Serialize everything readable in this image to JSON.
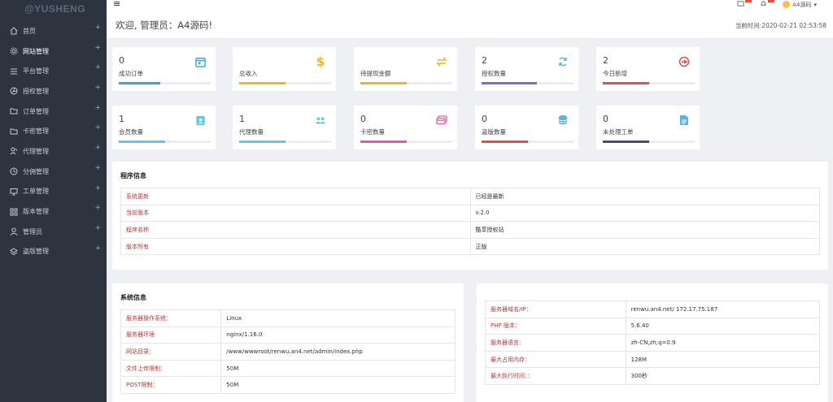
{
  "brand": "@YUSHENG",
  "sidebar": {
    "items": [
      {
        "label": "首页",
        "icon": "home-icon"
      },
      {
        "label": "网站管理",
        "icon": "gear-icon"
      },
      {
        "label": "平台管理",
        "icon": "list-icon"
      },
      {
        "label": "授权管理",
        "icon": "aperture-icon"
      },
      {
        "label": "订单管理",
        "icon": "folder-icon"
      },
      {
        "label": "卡密管理",
        "icon": "folder-icon"
      },
      {
        "label": "代理管理",
        "icon": "users-icon"
      },
      {
        "label": "分佣管理",
        "icon": "clock-icon"
      },
      {
        "label": "工单管理",
        "icon": "monitor-icon"
      },
      {
        "label": "版本管理",
        "icon": "grid-icon"
      },
      {
        "label": "管理员",
        "icon": "user-icon"
      },
      {
        "label": "盗版管理",
        "icon": "layers-icon"
      }
    ],
    "plus": "+"
  },
  "topbar": {
    "menu_toggle": "≡",
    "user_name": "A4源码"
  },
  "header": {
    "welcome": "欢迎, 管理员：A4源码!",
    "time_label": "当前时间:",
    "time_value": "2020-02-21 02:53:58"
  },
  "stats_row1": [
    {
      "value": "0",
      "label": "成功订单",
      "icon": "calendar-icon",
      "color": "#3aa6c9",
      "progress": 0.45
    },
    {
      "value": "",
      "label": "总收入",
      "icon": "dollar-icon",
      "color": "#f0b323",
      "progress": 0.5
    },
    {
      "value": "",
      "label": "待提现金额",
      "icon": "exchange-icon",
      "color": "#f0b323",
      "progress": 0.5
    },
    {
      "value": "2",
      "label": "授权数量",
      "icon": "sync-icon",
      "color": "#6c6fe0",
      "progress": 0.6
    },
    {
      "value": "2",
      "label": "今日新增",
      "icon": "target-icon",
      "color": "#e24d4d",
      "progress": 0.5
    }
  ],
  "stats_row2": [
    {
      "value": "1",
      "label": "会员数量",
      "icon": "contact-icon",
      "color": "#5fc8e4",
      "progress": 0.5
    },
    {
      "value": "1",
      "label": "代理数量",
      "icon": "group-icon",
      "color": "#5fc8e4",
      "progress": 0.5
    },
    {
      "value": "0",
      "label": "卡密数量",
      "icon": "card-icon",
      "color": "#e05ca6",
      "progress": 0.5
    },
    {
      "value": "0",
      "label": "盗版数量",
      "icon": "database-icon",
      "color": "#e24d4d",
      "progress": 0.5
    },
    {
      "value": "0",
      "label": "未处理工单",
      "icon": "file-icon",
      "color": "#4a4e6e",
      "progress": 0.5
    }
  ],
  "program_info": {
    "title": "程序信息",
    "rows": [
      {
        "key": "系统更新",
        "value": "已经是最新"
      },
      {
        "key": "当前版本",
        "value": "v.2.0"
      },
      {
        "key": "程序名称",
        "value": "酷享授权站"
      },
      {
        "key": "版本所有",
        "value": "正版"
      }
    ]
  },
  "system_info": {
    "title": "系统信息",
    "rows": [
      {
        "key": "服务器操作系统：",
        "value": "Linux"
      },
      {
        "key": "服务器环境",
        "value": "nginx/1.16.0"
      },
      {
        "key": "网站目录：",
        "value": "/www/wwwroot/renwu.an4.net/admin/index.php"
      },
      {
        "key": "文件上传限制：",
        "value": "50M"
      },
      {
        "key": "POST限制：",
        "value": "50M"
      }
    ]
  },
  "server_info": {
    "rows": [
      {
        "key": "服务器域名/IP：",
        "value": "renwu.an4.net/ 172.17.75.187"
      },
      {
        "key": "PHP 版本：",
        "value": "5.6.40"
      },
      {
        "key": "服务器语言：",
        "value": "zh-CN,zh;q=0.9"
      },
      {
        "key": "最大占用内存：",
        "value": "128M"
      },
      {
        "key": "最大执行时间：：",
        "value": "300秒"
      }
    ]
  }
}
